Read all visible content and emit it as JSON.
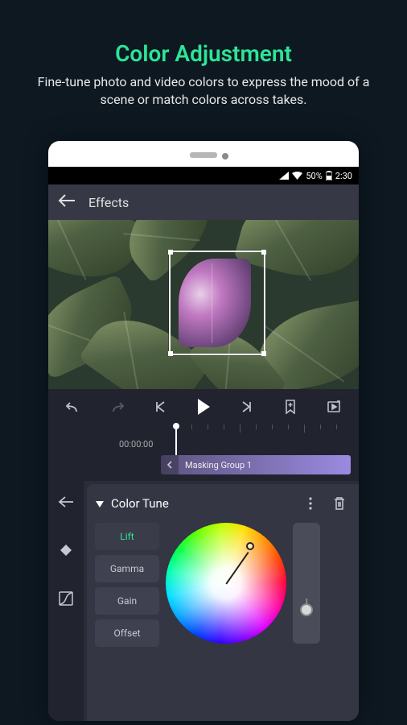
{
  "promo": {
    "title": "Color Adjustment",
    "subtitle": "Fine-tune photo and video colors to express the mood of a scene or match colors across takes."
  },
  "statusbar": {
    "battery_pct": "50%",
    "time": "2:30"
  },
  "header": {
    "title": "Effects"
  },
  "timeline": {
    "timecode": "00:00:00",
    "clip_label": "Masking Group 1"
  },
  "panel": {
    "title": "Color Tune",
    "tabs": [
      {
        "label": "Lift",
        "active": true
      },
      {
        "label": "Gamma",
        "active": false
      },
      {
        "label": "Gain",
        "active": false
      },
      {
        "label": "Offset",
        "active": false
      }
    ]
  },
  "colors": {
    "accent": "#2ce597",
    "bg_dark": "#0d1821",
    "app_bg": "#21232e",
    "panel_bg": "#343644"
  }
}
